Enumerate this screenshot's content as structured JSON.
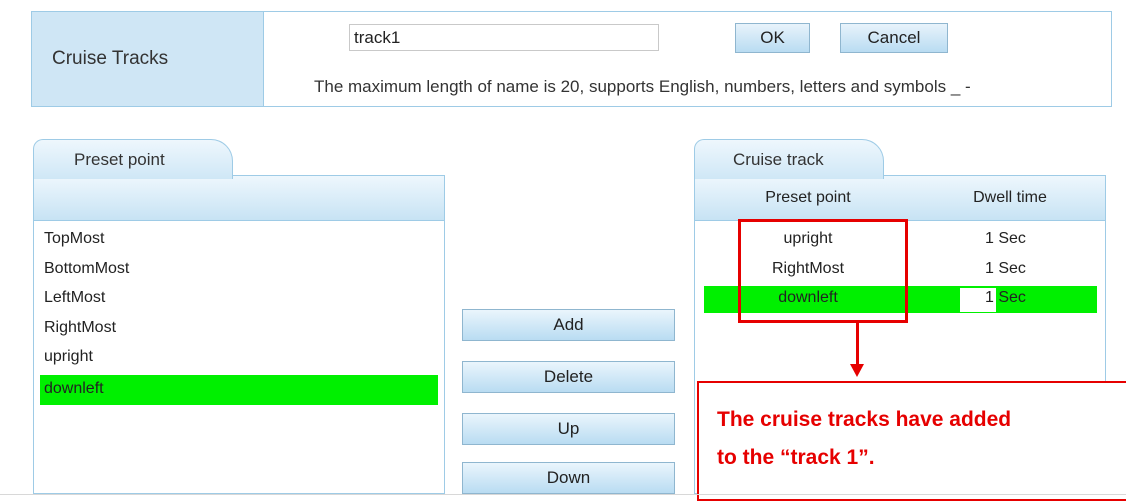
{
  "header": {
    "label": "Cruise Tracks",
    "name_value": "track1",
    "ok_label": "OK",
    "cancel_label": "Cancel",
    "hint": "The maximum length of name is 20, supports English, numbers, letters and symbols _ -"
  },
  "preset_panel": {
    "tab_label": "Preset point",
    "items": [
      "TopMost",
      "BottomMost",
      "LeftMost",
      "RightMost",
      "upright",
      "downleft"
    ],
    "selected_item": "downleft"
  },
  "actions": {
    "add": "Add",
    "delete": "Delete",
    "up": "Up",
    "down": "Down"
  },
  "cruise_panel": {
    "tab_label": "Cruise track",
    "col_preset": "Preset point",
    "col_dwell": "Dwell time",
    "rows": [
      {
        "preset": "upright",
        "dwell": "1",
        "unit": "Sec"
      },
      {
        "preset": "RightMost",
        "dwell": "1",
        "unit": "Sec"
      },
      {
        "preset": "downleft",
        "dwell": "1",
        "unit": "Sec"
      }
    ]
  },
  "annotation": {
    "line1": "The cruise tracks have added",
    "line2": "to the “track 1”.",
    "color": "#e60000"
  },
  "colors": {
    "selection": "#00f000",
    "panel_blue": "#cfe6f5"
  }
}
